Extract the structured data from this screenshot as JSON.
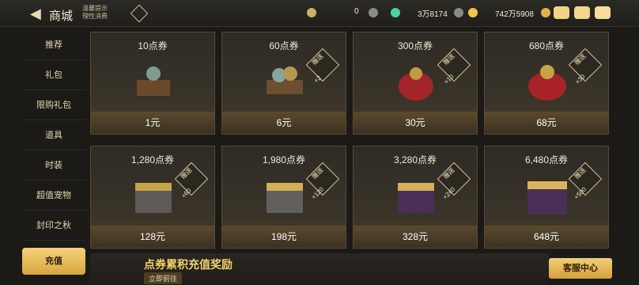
{
  "header": {
    "title": "商城",
    "subtitle_line1": "温馨提示",
    "subtitle_line2": "理性消费",
    "currencies": [
      {
        "value": "0",
        "icon": "ticket-icon"
      },
      {
        "value": "3万8174",
        "icon": "gem-icon"
      },
      {
        "value": "742万5908",
        "icon": "gold-coin-icon"
      }
    ],
    "icons": [
      "gift-icon",
      "mail-icon",
      "chat-icon"
    ]
  },
  "sidebar": {
    "items": [
      "推荐",
      "礼包",
      "限购礼包",
      "道具",
      "时装",
      "超值宠物",
      "封印之秋"
    ],
    "recharge_label": "充值"
  },
  "cards": [
    {
      "name": "10点券",
      "price": "1元",
      "bonus": ""
    },
    {
      "name": "60点券",
      "price": "6元",
      "bonus": "+2"
    },
    {
      "name": "300点券",
      "price": "30元",
      "bonus": "+10"
    },
    {
      "name": "680点券",
      "price": "68元",
      "bonus": "+30"
    },
    {
      "name": "1,280点券",
      "price": "128元",
      "bonus": "+60"
    },
    {
      "name": "1,980点券",
      "price": "198元",
      "bonus": "+120"
    },
    {
      "name": "3,280点券",
      "price": "328元",
      "bonus": "+240"
    },
    {
      "name": "6,480点券",
      "price": "648元",
      "bonus": "+500"
    }
  ],
  "badge_label": "赠送",
  "promo": {
    "title": "点券累积充值奖励",
    "button": "立即前往"
  },
  "customer_service": "客服中心",
  "colors": {
    "accent_gold": "#d9a640",
    "background": "#1b1a17"
  }
}
